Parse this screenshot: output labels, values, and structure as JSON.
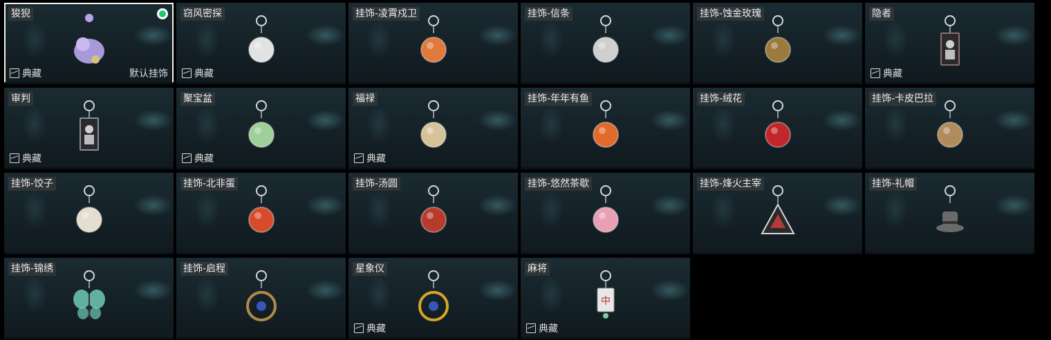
{
  "collect_label": "典藏",
  "default_label": "默认挂饰",
  "items": [
    {
      "name": "狻猊",
      "collect": true,
      "default": true,
      "selected": true,
      "icon": "lion-charm-icon",
      "color": "#a79ad8"
    },
    {
      "name": "窃风密探",
      "collect": true,
      "default": false,
      "selected": false,
      "icon": "figure-charm-icon",
      "color": "#e2e2e2"
    },
    {
      "name": "挂饰-凌霄戍卫",
      "collect": false,
      "default": false,
      "selected": false,
      "icon": "rocket-charm-icon",
      "color": "#e07a3a"
    },
    {
      "name": "挂饰-信条",
      "collect": false,
      "default": false,
      "selected": false,
      "icon": "goblet-charm-icon",
      "color": "#cfcfcf"
    },
    {
      "name": "挂饰-蚀金玫瑰",
      "collect": false,
      "default": false,
      "selected": false,
      "icon": "gold-rose-charm-icon",
      "color": "#9c7a3c"
    },
    {
      "name": "隐者",
      "collect": true,
      "default": false,
      "selected": false,
      "icon": "tarot-card-charm-icon",
      "color": "#8b6e6e"
    },
    {
      "name": "审判",
      "collect": true,
      "default": false,
      "selected": false,
      "icon": "judgement-card-charm-icon",
      "color": "#8a8d9c"
    },
    {
      "name": "聚宝盆",
      "collect": true,
      "default": false,
      "selected": false,
      "icon": "treasure-bowl-charm-icon",
      "color": "#9fcf9a"
    },
    {
      "name": "福禄",
      "collect": true,
      "default": false,
      "selected": false,
      "icon": "gourd-charm-icon",
      "color": "#d7c39a"
    },
    {
      "name": "挂饰-年年有鱼",
      "collect": false,
      "default": false,
      "selected": false,
      "icon": "fish-charm-icon",
      "color": "#e06a2a"
    },
    {
      "name": "挂饰-绒花",
      "collect": false,
      "default": false,
      "selected": false,
      "icon": "velvet-flower-charm-icon",
      "color": "#c0262a"
    },
    {
      "name": "挂饰-卡皮巴拉",
      "collect": false,
      "default": false,
      "selected": false,
      "icon": "capybara-charm-icon",
      "color": "#b08b5b"
    },
    {
      "name": "挂饰-饺子",
      "collect": false,
      "default": false,
      "selected": false,
      "icon": "dumpling-plate-charm-icon",
      "color": "#e4ddd0"
    },
    {
      "name": "挂饰-北非蛋",
      "collect": false,
      "default": false,
      "selected": false,
      "icon": "shakshuka-charm-icon",
      "color": "#d74b2b"
    },
    {
      "name": "挂饰-汤圆",
      "collect": false,
      "default": false,
      "selected": false,
      "icon": "tangyuan-bowl-charm-icon",
      "color": "#b83a2a"
    },
    {
      "name": "挂饰-悠然茶歇",
      "collect": false,
      "default": false,
      "selected": false,
      "icon": "cupcake-charm-icon",
      "color": "#e8a0b4"
    },
    {
      "name": "挂饰-烽火主宰",
      "collect": false,
      "default": false,
      "selected": false,
      "icon": "triangle-emblem-charm-icon",
      "color": "#b33a3a"
    },
    {
      "name": "挂饰-礼帽",
      "collect": false,
      "default": false,
      "selected": false,
      "icon": "top-hat-charm-icon",
      "color": "#6a6a6a"
    },
    {
      "name": "挂饰-锦绣",
      "collect": false,
      "default": false,
      "selected": false,
      "icon": "butterfly-charm-icon",
      "color": "#6fc9b8"
    },
    {
      "name": "挂饰-启程",
      "collect": false,
      "default": false,
      "selected": false,
      "icon": "compass-ring-charm-icon",
      "color": "#b08b4a"
    },
    {
      "name": "星象仪",
      "collect": true,
      "default": false,
      "selected": false,
      "icon": "astrolabe-charm-icon",
      "color": "#d6a52a"
    },
    {
      "name": "麻将",
      "collect": true,
      "default": false,
      "selected": false,
      "icon": "mahjong-tile-charm-icon",
      "color": "#e8e8e8"
    }
  ]
}
